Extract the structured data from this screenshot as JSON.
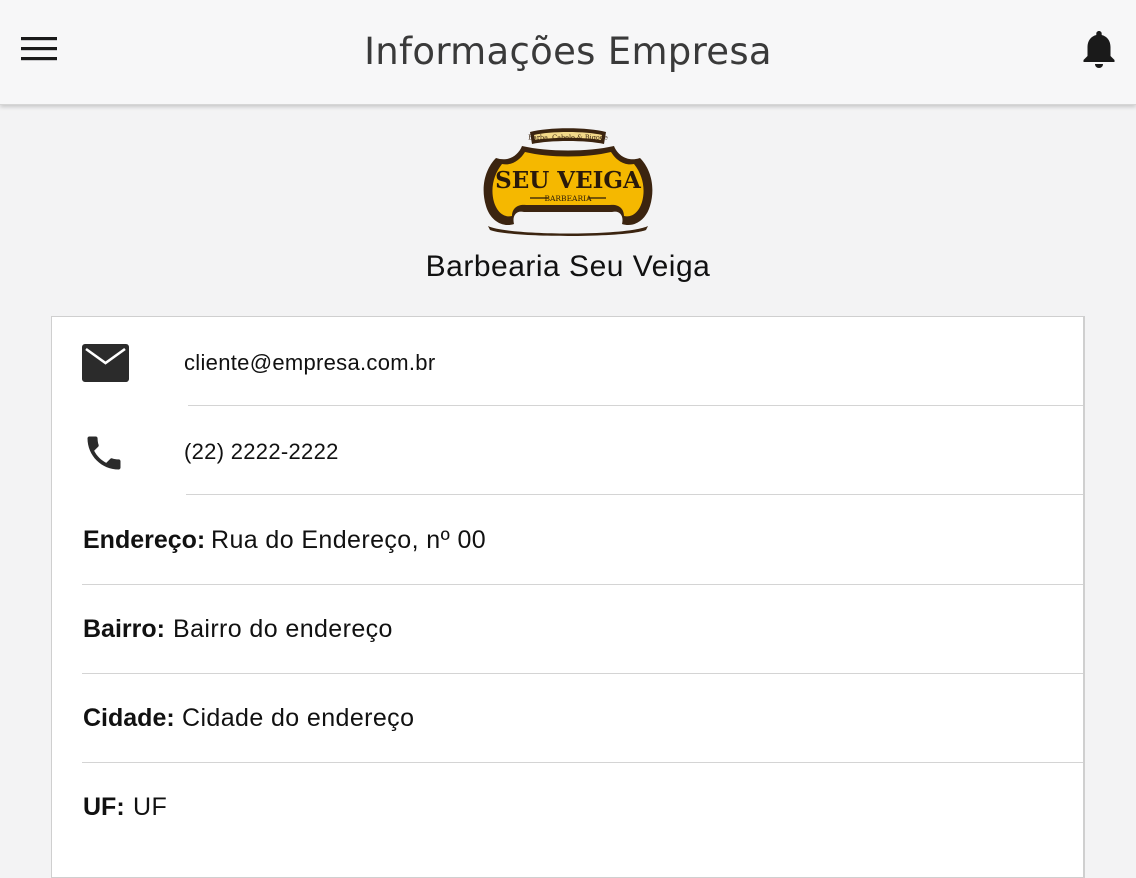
{
  "header": {
    "title": "Informações Empresa",
    "menu_icon": "hamburger-menu-icon",
    "notification_icon": "bell-icon"
  },
  "company": {
    "name": "Barbearia Seu Veiga",
    "logo": {
      "banner_text": "Barba, Cabelo & Bigode",
      "main_text": "SEU VEIGA",
      "sub_text": "BARBEARIA"
    }
  },
  "contact": {
    "email": "cliente@empresa.com.br",
    "email_icon": "mail-icon",
    "phone": "(22) 2222-2222",
    "phone_icon": "phone-icon"
  },
  "address": {
    "endereco_label": "Endereço:",
    "endereco_value": "Rua do Endereço, nº 00",
    "bairro_label": "Bairro:",
    "bairro_value": "Bairro do endereço",
    "cidade_label": "Cidade:",
    "cidade_value": "Cidade do endereço",
    "uf_label": "UF:",
    "uf_value": "UF"
  },
  "colors": {
    "header_bg": "#f7f7f8",
    "page_bg": "#f3f3f4",
    "logo_gold": "#f5b800",
    "logo_dark": "#3b2410"
  }
}
